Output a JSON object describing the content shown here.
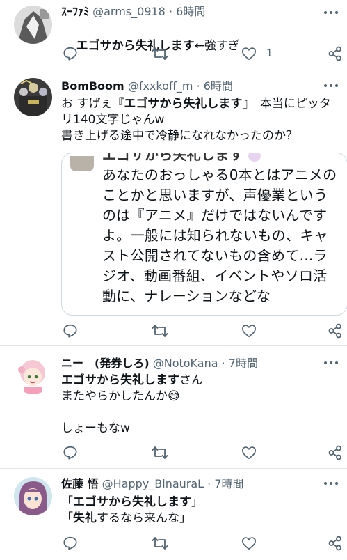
{
  "tweets": [
    {
      "name": "ｽｰﾌｧﾐ",
      "handle": "@arms_0918",
      "time": "6時間",
      "text_bold": "エゴサから失礼します",
      "text_rest": "←強すぎ",
      "like_count": "1"
    },
    {
      "name": "BomBoom",
      "handle": "@fxxkoff_m",
      "time": "6時間",
      "line1_a": "お すげぇ『",
      "line1_bold": "エゴサから失礼します",
      "line1_b": "』　本当にピッタ",
      "line2": "リ140文字じゃんw",
      "line3": "書き上げる途中で冷静になれなかったのか？",
      "quote": {
        "header_partial": "エゴサから失礼します",
        "text": "あなたのおっしゃる0本とはアニメのことかと思いますが、声優業というのは『アニメ』だけではないんですよ。一般には知られないもの、キャスト公開されてないもの含めて...ラジオ、動画番組、イベントやソロ活動に、ナレーションなどな"
      }
    },
    {
      "name": "ニー　(発券しろ)",
      "handle": "@NotoKana",
      "time": "7時間",
      "line1_bold": "エゴサから失礼します",
      "line1_rest": "さん",
      "line2": "またやらかしたんか",
      "emoji": "😅",
      "line4": "しょーもなw"
    },
    {
      "name": "佐藤 悟",
      "handle": "@Happy_BinauraL",
      "time": "7時間",
      "line1_a": "「",
      "line1_bold": "エゴサから失礼します",
      "line1_b": "」",
      "line2_a": "「",
      "line2_bold": "失礼",
      "line2_b": "するなら来んな」"
    }
  ],
  "separator": " · ",
  "icons": [
    "reply-icon",
    "retweet-icon",
    "like-icon",
    "share-icon",
    "more-icon"
  ],
  "colors": {
    "text": "#0f1419",
    "secondary": "#536471",
    "divider": "#e1e6ea"
  }
}
